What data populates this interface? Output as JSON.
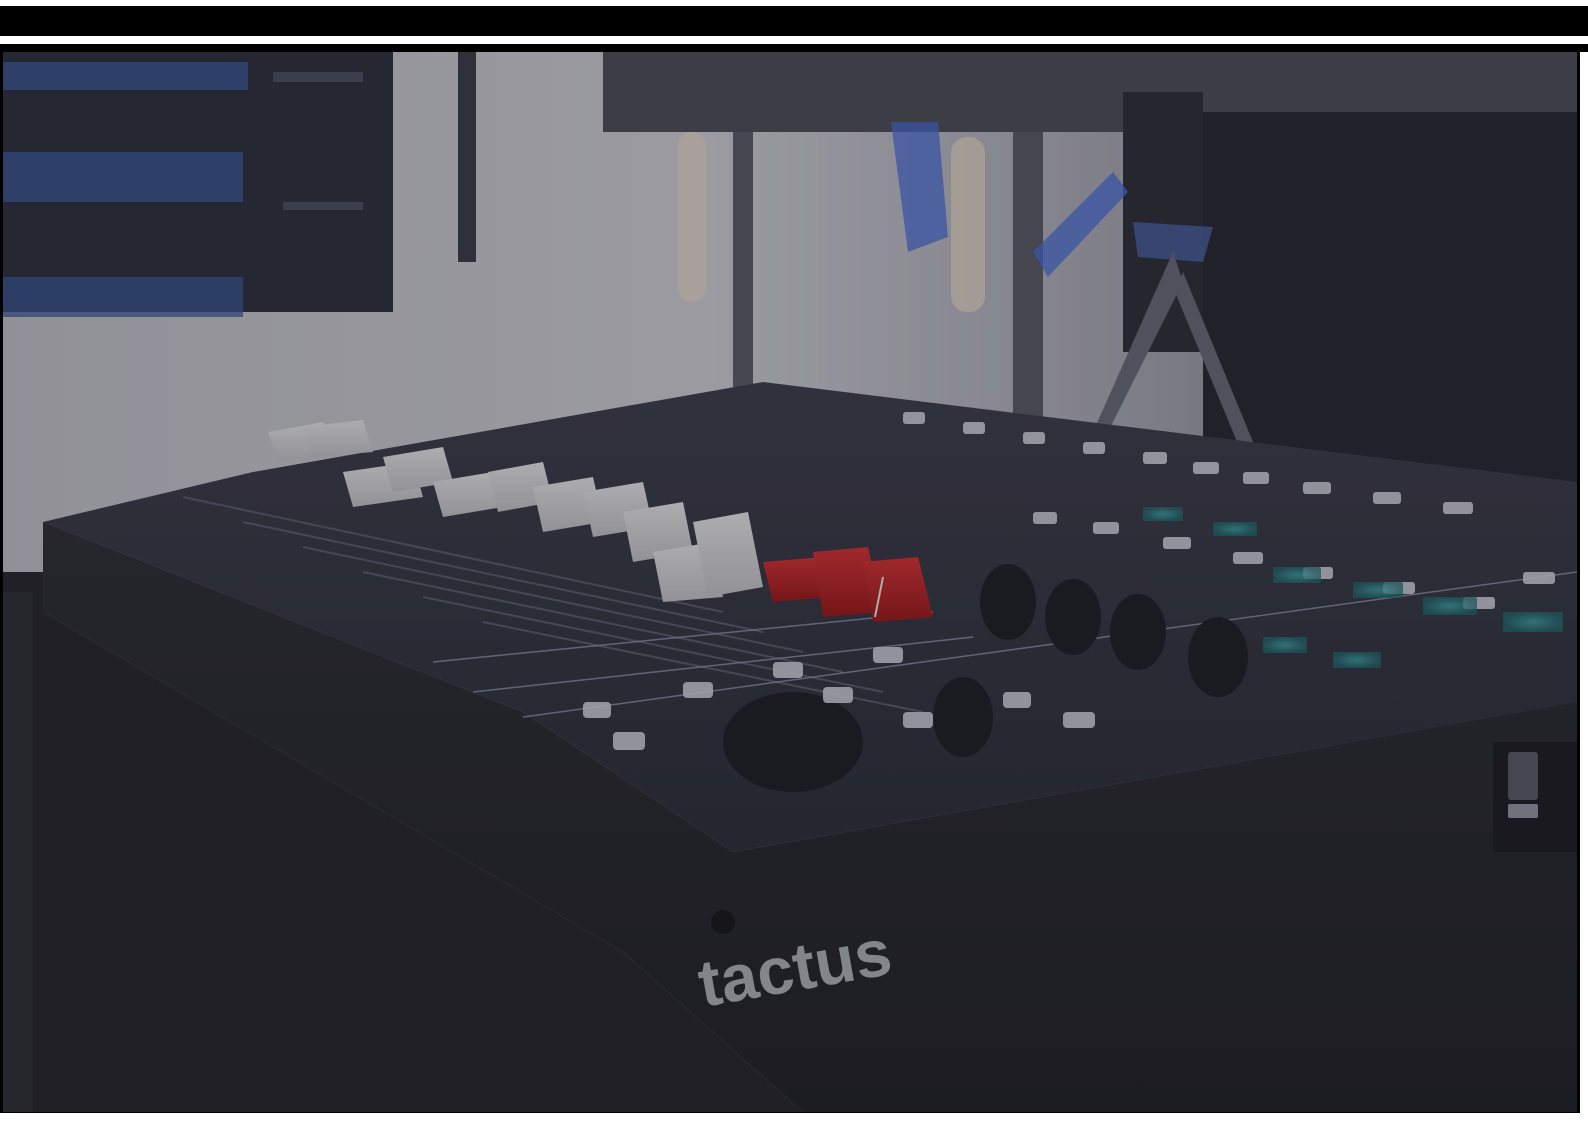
{
  "photo": {
    "subject": "mixing-console",
    "brand_text": "tactus",
    "colors": {
      "panel": "#2a2b33",
      "fader_white": "#e6e6e6",
      "fader_red": "#c81e1e",
      "led_teal": "#2fa9a8",
      "wall": "#bdbcc2",
      "overlay": "#1c1c26"
    }
  }
}
